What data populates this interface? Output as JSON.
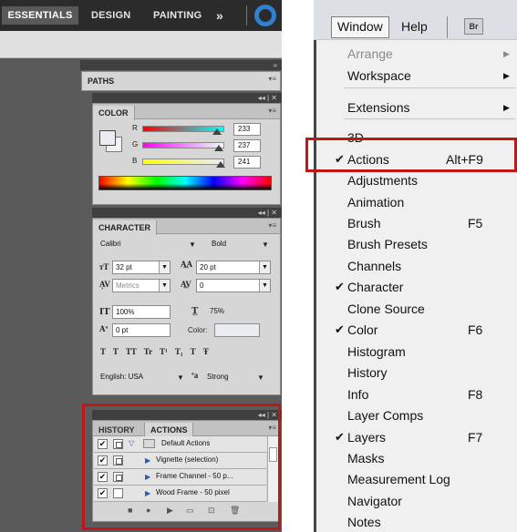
{
  "workspaces": {
    "essentials": "ESSENTIALS",
    "design": "DESIGN",
    "painting": "PAINTING",
    "more": "»"
  },
  "paths_panel": {
    "tab": "PATHS"
  },
  "color_panel": {
    "tab": "COLOR",
    "channels": [
      {
        "label": "R",
        "value": "233",
        "fraction": 0.91,
        "color_start": "#ff0000",
        "color_end": "#00ffff"
      },
      {
        "label": "G",
        "value": "237",
        "fraction": 0.93,
        "color_start": "#ff00ff",
        "color_end": "#e9ffff"
      },
      {
        "label": "B",
        "value": "241",
        "fraction": 0.95,
        "color_start": "#ffff00",
        "color_end": "#e9edff"
      }
    ]
  },
  "character_panel": {
    "tab": "CHARACTER",
    "font_family": "Calibri",
    "font_style": "Bold",
    "font_size": "32 pt",
    "leading": "20 pt",
    "kerning": "Metrics",
    "tracking": "0",
    "vertical_scale": "100%",
    "horizontal_scale": "75%",
    "baseline_shift": "0 pt",
    "color_label": "Color:",
    "style_buttons": "T T TT Tr T¹ T₁ T Ŧ",
    "language": "English: USA",
    "aa_label": "ªa",
    "antialias": "Strong"
  },
  "actions_panel": {
    "tabs": [
      "HISTORY",
      "ACTIONS"
    ],
    "rows": [
      {
        "name": "Default Actions",
        "checked": "✔",
        "dialog": true,
        "kind": "set"
      },
      {
        "name": "Vignette (selection)",
        "checked": "✔",
        "dialog": true,
        "kind": "action"
      },
      {
        "name": "Frame Channel - 50 p...",
        "checked": "✔",
        "dialog": true,
        "kind": "action"
      },
      {
        "name": "Wood Frame - 50 pixel",
        "checked": "✔",
        "dialog": false,
        "kind": "action"
      }
    ]
  },
  "menubar": {
    "window": "Window",
    "help": "Help",
    "bridge": "Br"
  },
  "window_menu": {
    "items": [
      {
        "label": "Arrange",
        "disabled": true,
        "submenu": true
      },
      {
        "label": "Workspace",
        "submenu": true
      },
      {
        "label": "Extensions",
        "submenu": true
      },
      {
        "label": "3D"
      },
      {
        "label": "Actions",
        "checked": true,
        "shortcut": "Alt+F9"
      },
      {
        "label": "Adjustments"
      },
      {
        "label": "Animation"
      },
      {
        "label": "Brush",
        "shortcut": "F5"
      },
      {
        "label": "Brush Presets"
      },
      {
        "label": "Channels"
      },
      {
        "label": "Character",
        "checked": true
      },
      {
        "label": "Clone Source"
      },
      {
        "label": "Color",
        "checked": true,
        "shortcut": "F6"
      },
      {
        "label": "Histogram"
      },
      {
        "label": "History"
      },
      {
        "label": "Info",
        "shortcut": "F8"
      },
      {
        "label": "Layer Comps"
      },
      {
        "label": "Layers",
        "checked": true,
        "shortcut": "F7"
      },
      {
        "label": "Masks"
      },
      {
        "label": "Measurement Log"
      },
      {
        "label": "Navigator"
      },
      {
        "label": "Notes"
      }
    ]
  },
  "colors": {
    "highlight": "#c11616",
    "ps_panel_bg": "#d6d6d6",
    "ps_workspace_bg": "#595959"
  }
}
